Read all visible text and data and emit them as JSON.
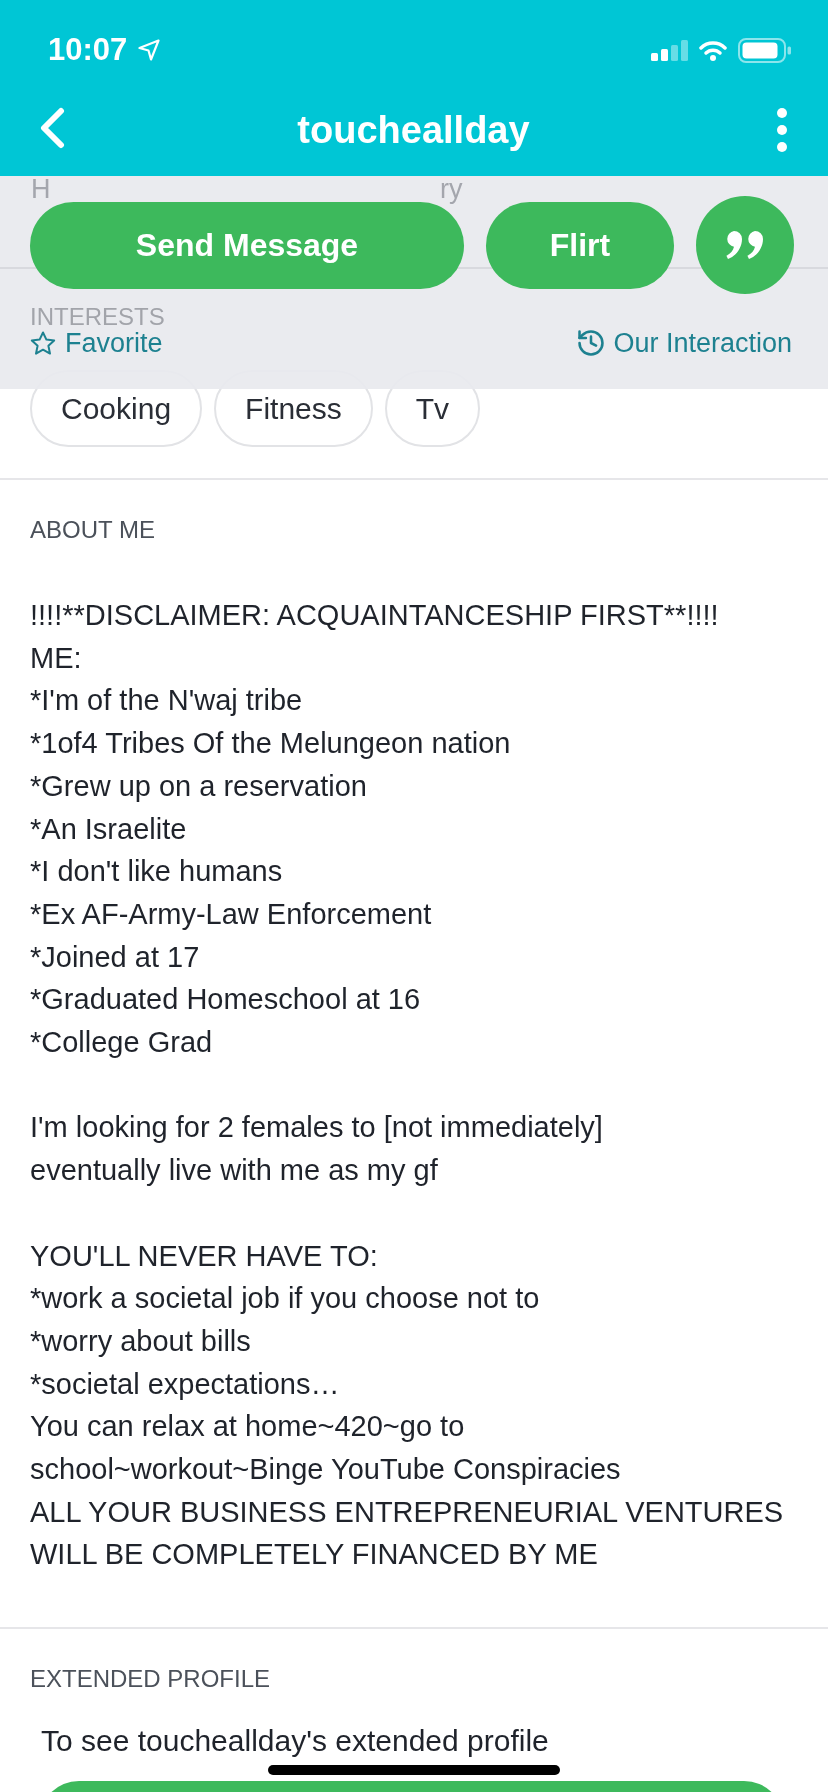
{
  "status_bar": {
    "time": "10:07"
  },
  "nav": {
    "title": "toucheallday"
  },
  "action_panel": {
    "obscured_text": [
      "H",
      "ry"
    ],
    "buttons": [
      {
        "kind": "wide",
        "label": "Send Message"
      },
      {
        "kind": "narrow",
        "label": "Flirt"
      },
      {
        "kind": "round"
      }
    ],
    "favorite": {
      "label": "Favorite",
      "on": false
    },
    "interaction_link": {
      "label": "Our Interaction"
    }
  },
  "interests": {
    "heading": "INTERESTS",
    "tags": [
      "Cooking",
      "Fitness",
      "Tv"
    ]
  },
  "about": {
    "heading": "ABOUT ME",
    "paragraphs": [
      [
        "!!!!**DISCLAIMER: ACQUAINTANCESHIP FIRST**!!!!",
        "ME:",
        "*I'm of the N'waj tribe",
        "*1of4 Tribes Of the Melungeon nation",
        "*Grew up on a reservation",
        "*An Israelite",
        "*I don't like humans",
        "*Ex AF-Army-Law Enforcement",
        "*Joined at 17",
        "*Graduated Homeschool at 16",
        "*College Grad"
      ],
      [
        "I'm looking for 2 females to [not immediately]",
        "eventually live with me as my gf"
      ],
      [
        "YOU'LL NEVER HAVE TO:",
        "*work a societal job if you choose not to",
        "*worry about bills",
        "*societal expectations…",
        "You can relax at home~420~go to",
        "school~workout~Binge YouTube Conspiracies",
        "ALL YOUR BUSINESS ENTREPRENEURIAL VENTURES",
        "WILL BE COMPLETELY FINANCED BY ME"
      ]
    ]
  },
  "extended_profile": {
    "heading": "EXTENDED PROFILE",
    "text": "To see toucheallday's extended profile",
    "button": {
      "kind": "pill"
    }
  }
}
